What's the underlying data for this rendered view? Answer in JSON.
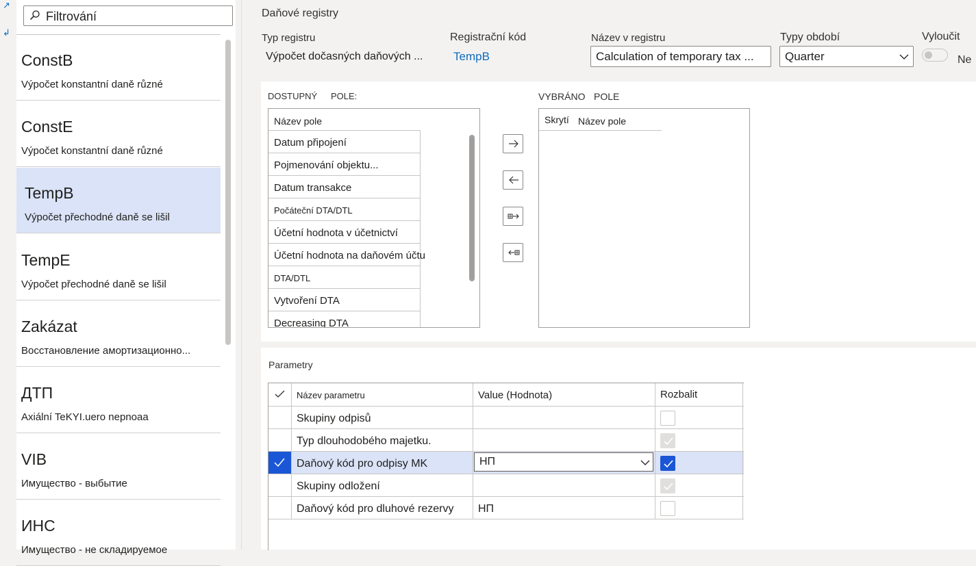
{
  "filter": {
    "placeholder": "Filtrování"
  },
  "list": {
    "items": [
      {
        "title": "ConstB",
        "subtitle": "Výpočet konstantní daně různé"
      },
      {
        "title": "ConstE",
        "subtitle": "Výpočet konstantní daně různé"
      },
      {
        "title": "TempB",
        "subtitle": "Výpočet přechodné daně se lišil",
        "selected": true
      },
      {
        "title": "TempE",
        "subtitle": "Výpočet přechodné daně se lišil"
      },
      {
        "title": "Zakázat",
        "subtitle": "Восстановление амортизационно..."
      },
      {
        "title": "ДТП",
        "subtitle": "Axiální TeKYI.uero nepnoaa"
      },
      {
        "title": "VIB",
        "subtitle": "Имущество - выбытие"
      },
      {
        "title": "ИНС",
        "subtitle": "Имущество - не складируемое"
      }
    ]
  },
  "header": {
    "section_title": "Daňové registry",
    "register_type": {
      "label": "Typ registru",
      "value": "Výpočet dočasných daňových ..."
    },
    "registration_code": {
      "label": "Registrační kód",
      "value": "TempB"
    },
    "register_name": {
      "label": "Název v registru",
      "value": "Calculation of temporary tax ..."
    },
    "period_types": {
      "label": "Typy období",
      "value": "Quarter"
    },
    "exclude": {
      "label": "Vyloučit",
      "value": "Ne"
    }
  },
  "fields": {
    "available_title_1": "DOSTUPNÝ",
    "available_title_2": "POLE:",
    "available_header": "Název pole",
    "available_items": [
      "Datum připojení",
      "Pojmenování objektu...",
      "Datum transakce",
      "Počáteční DTA/DTL",
      "Účetní hodnota v účetnictví",
      "Účetní hodnota na daňovém účtu",
      "DTA/DTL",
      "Vytvoření DTA",
      "Decreasing DTA"
    ],
    "selected_title_1": "VYBRÁNO",
    "selected_title_2": "POLE",
    "selected_col_hidden": "Skrytí",
    "selected_col_name": "Název pole"
  },
  "parameters": {
    "title": "Parametry",
    "columns": {
      "name": "Název parametru",
      "value": "Value (Hodnota)",
      "expand": "Rozbalit"
    },
    "rows": [
      {
        "name": "Skupiny odpisů",
        "value": "",
        "expand": "empty"
      },
      {
        "name": "Typ dlouhodobého majetku.",
        "value": "",
        "expand": "disabled-checked"
      },
      {
        "name": "Daňový kód pro odpisy MK",
        "value": "НП",
        "expand": "checked",
        "selected": true
      },
      {
        "name": "Skupiny odložení",
        "value": "",
        "expand": "disabled-checked"
      },
      {
        "name": "Daňový kód pro dluhové rezervy",
        "value": "НП",
        "expand": "empty"
      }
    ]
  },
  "colors": {
    "accent": "#1a56d6",
    "selected_row": "#dae3f7",
    "link": "#0f6cbd"
  }
}
